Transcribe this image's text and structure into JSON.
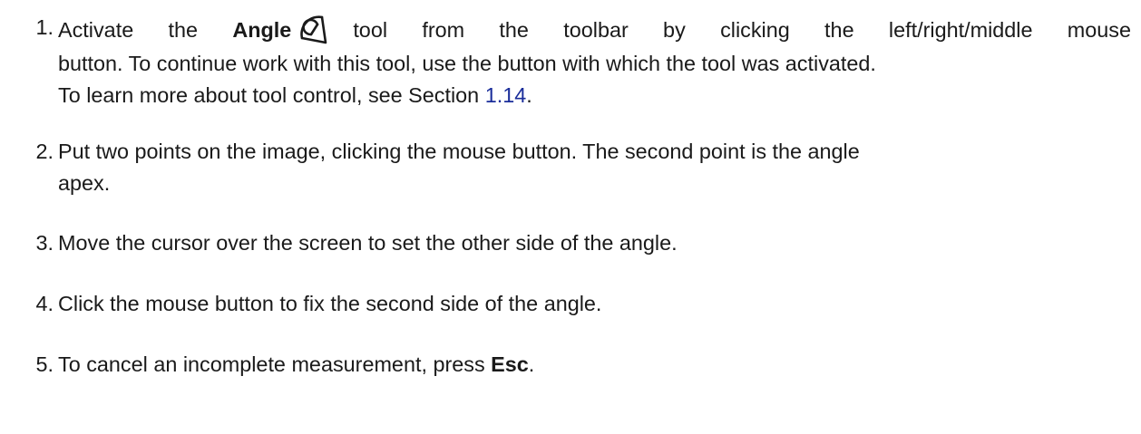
{
  "steps": [
    {
      "number": "1.",
      "line1_pre": "Activate the ",
      "line1_bold": "Angle",
      "line1_icon": "angle-tool-icon",
      "line1_post": "tool from the toolbar by clicking the left/right/middle mouse",
      "line2": "button. To continue work with this tool, use the button with which the tool was activated.",
      "line3_pre": "To learn more about tool control, see Section ",
      "line3_link": "1.14",
      "line3_post": "."
    },
    {
      "number": "2.",
      "line1": "Put two points on the image, clicking the mouse button. The second point is the angle",
      "line2": "apex."
    },
    {
      "number": "3.",
      "text": "Move the cursor over the screen to set the other side of the angle."
    },
    {
      "number": "4.",
      "text": "Click the mouse button to fix the second side of the angle."
    },
    {
      "number": "5.",
      "text_pre": "To cancel an incomplete measurement, press ",
      "text_bold": "Esc",
      "text_post": "."
    }
  ],
  "colors": {
    "text": "#1a1a1a",
    "link": "#1a2d9a"
  }
}
